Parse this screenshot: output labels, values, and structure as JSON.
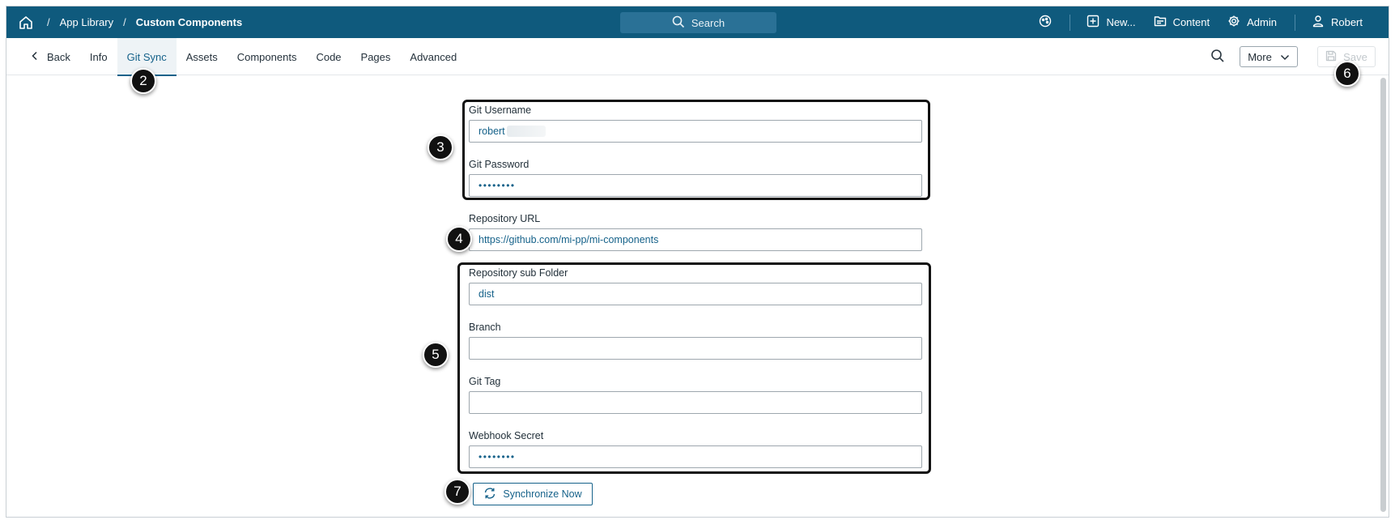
{
  "breadcrumb": {
    "items": [
      "App Library",
      "Custom Components"
    ],
    "separator": "/"
  },
  "topbar": {
    "search_label": "Search",
    "new_label": "New...",
    "content_label": "Content",
    "admin_label": "Admin",
    "user_label": "Robert"
  },
  "tabs": {
    "back_label": "Back",
    "items": [
      "Info",
      "Git Sync",
      "Assets",
      "Components",
      "Code",
      "Pages",
      "Advanced"
    ],
    "active": "Git Sync"
  },
  "toolbar": {
    "more_label": "More",
    "save_label": "Save"
  },
  "form": {
    "git_username": {
      "label": "Git Username",
      "value": "robert"
    },
    "git_password": {
      "label": "Git Password",
      "value": "••••••••"
    },
    "repository_url": {
      "label": "Repository URL",
      "value": "https://github.com/mi-pp/mi-components"
    },
    "repository_sub_folder": {
      "label": "Repository sub Folder",
      "value": "dist"
    },
    "branch": {
      "label": "Branch",
      "value": ""
    },
    "git_tag": {
      "label": "Git Tag",
      "value": ""
    },
    "webhook_secret": {
      "label": "Webhook Secret",
      "value": "••••••••"
    },
    "sync_label": "Synchronize Now"
  },
  "annotations": [
    "2",
    "3",
    "4",
    "5",
    "6",
    "7"
  ],
  "colors": {
    "topbar": "#0f5a7d",
    "accent": "#16628a",
    "annotation": "#111111"
  },
  "icons": {
    "home": "home-icon",
    "search": "search-icon",
    "palette": "palette-icon",
    "new": "plus-square-icon",
    "content": "folder-icon",
    "admin": "gear-icon",
    "user": "user-icon",
    "back": "chevron-left-icon",
    "more": "chevron-down-icon",
    "save": "floppy-icon",
    "sync": "refresh-icon"
  }
}
